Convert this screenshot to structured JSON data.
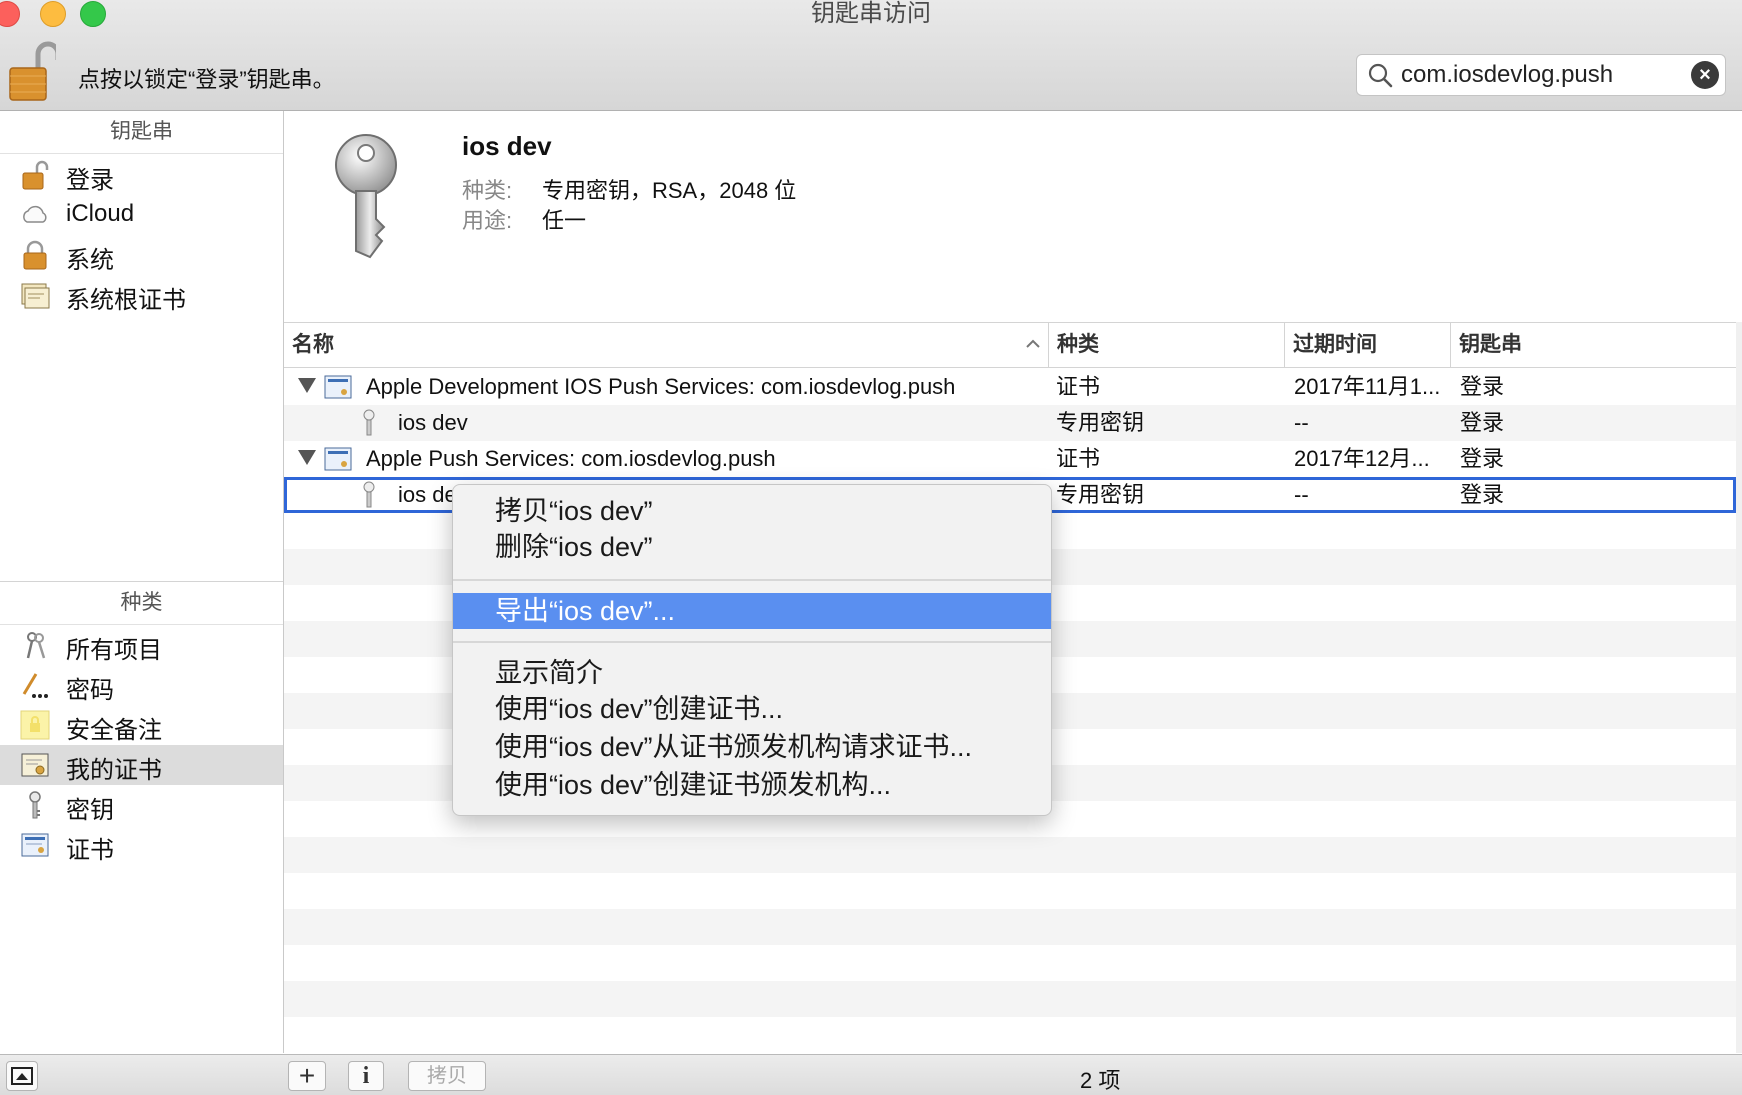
{
  "window": {
    "title": "钥匙串访问"
  },
  "toolbar": {
    "lock_text": "点按以锁定“登录”钥匙串。",
    "search": {
      "value": "com.iosdevlog.push",
      "placeholder": ""
    }
  },
  "sidebar": {
    "keychains_header": "钥匙串",
    "keychains": [
      {
        "label": "登录",
        "icon": "unlocked-lock-icon"
      },
      {
        "label": "iCloud",
        "icon": "cloud-icon"
      },
      {
        "label": "系统",
        "icon": "lock-icon"
      },
      {
        "label": "系统根证书",
        "icon": "certificate-folder-icon"
      }
    ],
    "category_header": "种类",
    "categories": [
      {
        "label": "所有项目",
        "icon": "all-items-icon"
      },
      {
        "label": "密码",
        "icon": "password-icon"
      },
      {
        "label": "安全备注",
        "icon": "secure-note-icon"
      },
      {
        "label": "我的证书",
        "icon": "my-certificate-icon",
        "selected": true
      },
      {
        "label": "密钥",
        "icon": "key-icon"
      },
      {
        "label": "证书",
        "icon": "certificate-icon"
      }
    ]
  },
  "detail": {
    "name": "ios dev",
    "kind_label": "种类:",
    "kind_value": "专用密钥，RSA，2048 位",
    "usage_label": "用途:",
    "usage_value": "任一"
  },
  "table": {
    "columns": [
      "名称",
      "种类",
      "过期时间",
      "钥匙串"
    ],
    "rows": [
      {
        "name": "Apple Development IOS Push Services: com.iosdevlog.push",
        "kind": "证书",
        "expires": "2017年11月1...",
        "keychain": "登录",
        "type": "certificate"
      },
      {
        "name": "ios dev",
        "kind": "专用密钥",
        "expires": "--",
        "keychain": "登录",
        "type": "key"
      },
      {
        "name": "Apple Push Services: com.iosdevlog.push",
        "kind": "证书",
        "expires": "2017年12月...",
        "keychain": "登录",
        "type": "certificate"
      },
      {
        "name": "ios dev",
        "kind": "专用密钥",
        "expires": "--",
        "keychain": "登录",
        "type": "key",
        "selected": true
      }
    ]
  },
  "context_menu": {
    "items": [
      {
        "label": "拷贝“ios dev”"
      },
      {
        "label": "删除“ios dev”"
      },
      {
        "label": "导出“ios dev”...",
        "highlighted": true
      },
      {
        "label": "显示简介"
      },
      {
        "label": "使用“ios dev”创建证书..."
      },
      {
        "label": "使用“ios dev”从证书颁发机构请求证书..."
      },
      {
        "label": "使用“ios dev”创建证书颁发机构..."
      }
    ]
  },
  "bottombar": {
    "add_label": "+",
    "info_label": "i",
    "copy_label": "拷贝",
    "item_count": "2 项"
  },
  "colors": {
    "selection_outline": "#2f66d8",
    "menu_highlight": "#5a8ff0",
    "close": "#fc605c",
    "minimize": "#fdbc40",
    "maximize": "#34c84a"
  }
}
